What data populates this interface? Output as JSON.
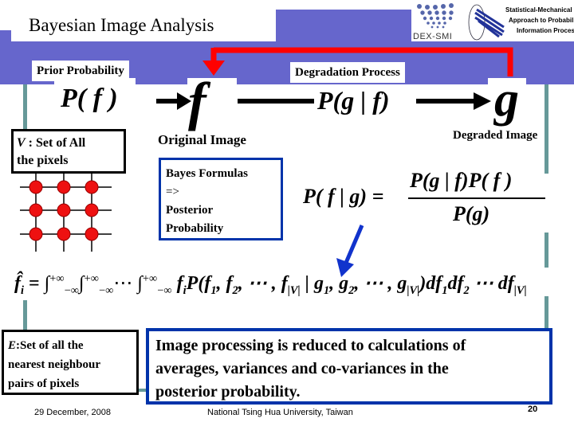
{
  "slide": {
    "title": "Bayesian Image Analysis",
    "logos": {
      "dex_smi_label": "DEX-SMI",
      "smapip_line1": "Statistical-Mechanical",
      "smapip_line2": "Approach to Probabilistic",
      "smapip_line3": "Information Processing"
    },
    "labels": {
      "prior_probability": "Prior Probability",
      "degradation_process": "Degradation Process",
      "original_image": "Original Image",
      "degraded_image": "Degraded Image"
    },
    "formulas": {
      "prior": "P( f )",
      "original": "f",
      "likelihood": "P(g | f)",
      "degraded": "g",
      "bayes_lhs": "P( f | g) =",
      "bayes_num": "P(g | f)P( f )",
      "bayes_den": "P(g)",
      "estimate_lhs": "f̂",
      "estimate_sub": "i",
      "estimate_eq": "=",
      "estimate_body": "f_i P(f_1, f_2, …, f_|V| | g_1, g_2, …, g_|V|) df_1 df_2 … df_|V|"
    },
    "v_box": {
      "symbol": "V",
      "text_line1": " : Set of All",
      "text_line2": "the pixels"
    },
    "bayes_box": {
      "line1": "Bayes Formulas",
      "line2": "=>",
      "line3": "Posterior",
      "line4": "Probability"
    },
    "e_box": {
      "symbol": "E",
      "text_line1": ":Set of all the",
      "text_line2": "nearest neighbour",
      "text_line3": "pairs of pixels"
    },
    "conclusion": {
      "line1": "Image processing is reduced to calculations of",
      "line2": "averages, variances and co-variances in the",
      "line3": "posterior probability."
    },
    "footer": {
      "date": "29 December, 2008",
      "institution": "National Tsing Hua University, Taiwan",
      "page_number": "20"
    },
    "colors": {
      "band": "#6666cc",
      "teal": "#669999",
      "red_arrow": "#ff0000",
      "blue_border": "#0033aa",
      "pixel_node": "#ee1111"
    }
  }
}
